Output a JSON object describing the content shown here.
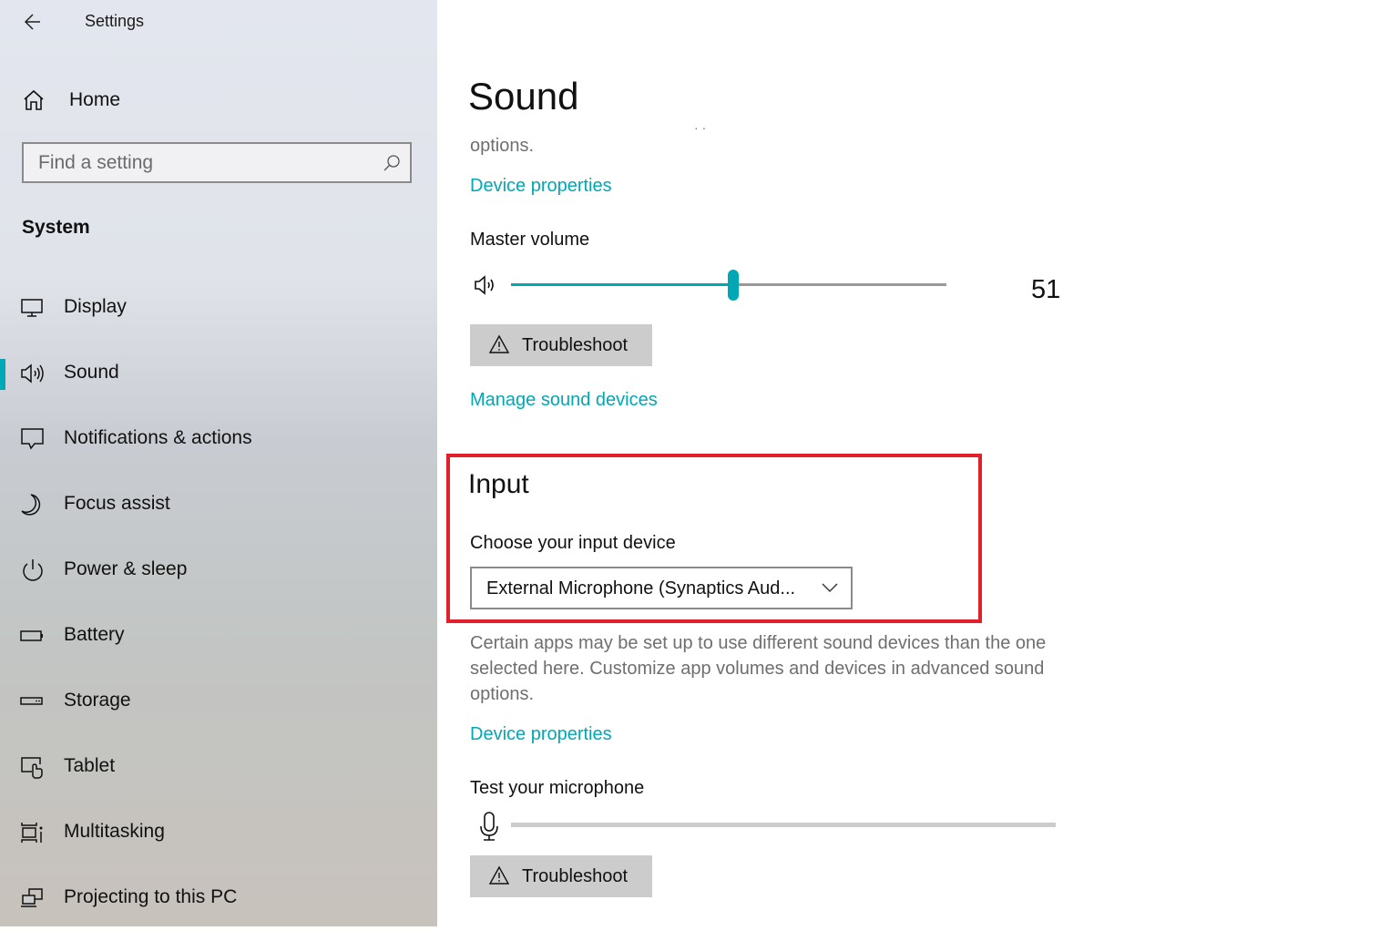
{
  "app": {
    "title": "Settings",
    "back_icon": "back-arrow-icon"
  },
  "sidebar": {
    "home_label": "Home",
    "home_icon": "home-icon",
    "search": {
      "placeholder": "Find a setting",
      "value": "",
      "icon": "search-icon"
    },
    "section_title": "System",
    "items": [
      {
        "label": "Display",
        "icon": "display-icon",
        "active": false
      },
      {
        "label": "Sound",
        "icon": "speaker-icon",
        "active": true
      },
      {
        "label": "Notifications & actions",
        "icon": "notification-icon",
        "active": false
      },
      {
        "label": "Focus assist",
        "icon": "moon-icon",
        "active": false
      },
      {
        "label": "Power & sleep",
        "icon": "power-icon",
        "active": false
      },
      {
        "label": "Battery",
        "icon": "battery-icon",
        "active": false
      },
      {
        "label": "Storage",
        "icon": "storage-icon",
        "active": false
      },
      {
        "label": "Tablet",
        "icon": "tablet-icon",
        "active": false
      },
      {
        "label": "Multitasking",
        "icon": "multitasking-icon",
        "active": false
      },
      {
        "label": "Projecting to this PC",
        "icon": "projecting-icon",
        "active": false
      }
    ]
  },
  "main": {
    "page_title": "Sound",
    "output": {
      "options_tail": "options.",
      "device_properties_link": "Device properties",
      "master_volume_label": "Master volume",
      "master_volume_value": "51",
      "master_volume_percent": 51,
      "troubleshoot_label": "Troubleshoot",
      "manage_devices_link": "Manage sound devices"
    },
    "input": {
      "title": "Input",
      "choose_label": "Choose your input device",
      "selected_device": "External Microphone (Synaptics Aud...",
      "description": "Certain apps may be set up to use different sound devices than the one selected here. Customize app volumes and devices in advanced sound options.",
      "device_properties_link": "Device properties",
      "test_mic_label": "Test your microphone",
      "mic_level_percent": 0,
      "troubleshoot_label": "Troubleshoot"
    }
  },
  "colors": {
    "accent": "#00a8b5",
    "highlight_box": "#e0202a",
    "button_bg": "#cccccc"
  }
}
